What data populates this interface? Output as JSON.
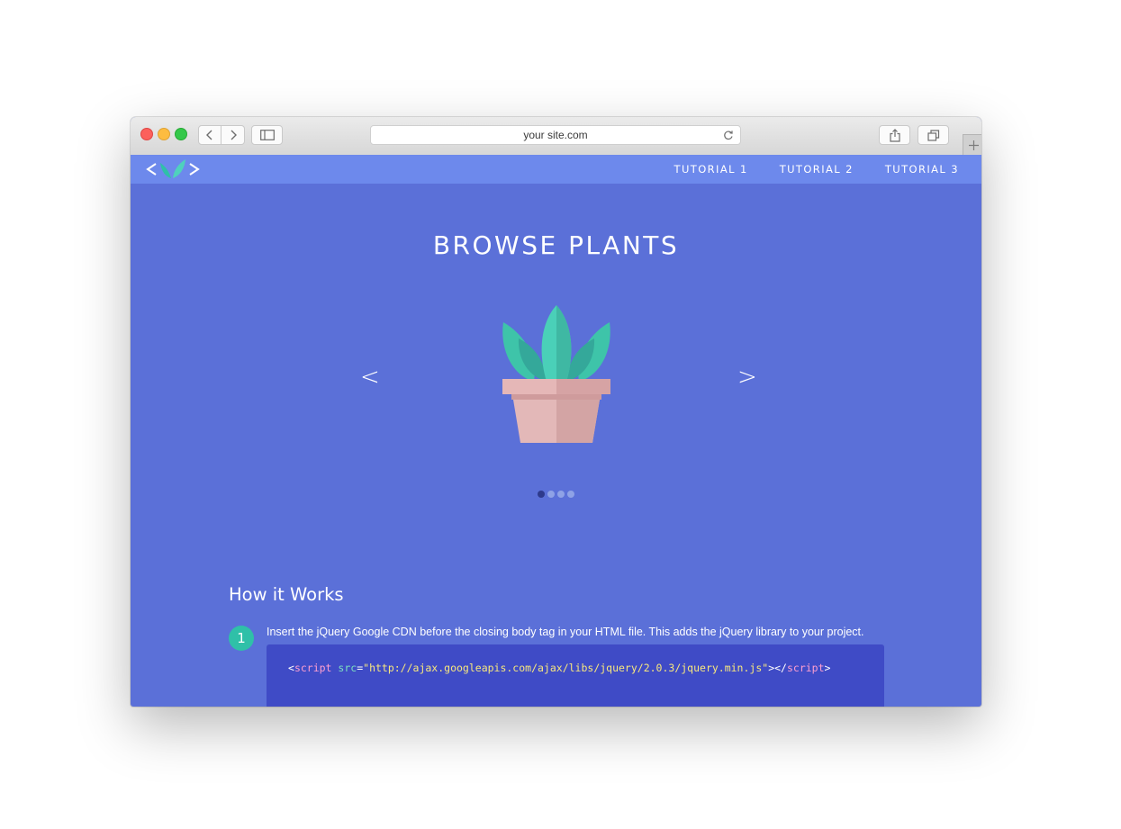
{
  "browser": {
    "url": "your site.com"
  },
  "nav": {
    "links": [
      "TUTORIAL 1",
      "TUTORIAL 2",
      "TUTORIAL 3"
    ]
  },
  "hero": {
    "title": "BROWSE PLANTS",
    "prev_label": "<",
    "next_label": ">",
    "slide_count": 4,
    "active_slide": 1
  },
  "how": {
    "title": "How it Works",
    "step_number": "1",
    "step_text": "Insert the jQuery Google CDN before the closing body tag in your HTML file. This adds the jQuery library to your project.",
    "code": {
      "open_bracket": "<",
      "tag": "script",
      "attr": "src",
      "equals": "=",
      "value": "\"http://ajax.googleapis.com/ajax/libs/jquery/2.0.3/jquery.min.js\"",
      "close_open": "></",
      "close_tag": "script",
      "end": ">"
    }
  },
  "colors": {
    "page_bg": "#5b70d8",
    "nav_bg": "#6d89ec",
    "accent_green": "#2fc0a8",
    "code_bg": "#3f4bc6"
  },
  "icons": [
    "back-icon",
    "forward-icon",
    "sidebar-icon",
    "reload-icon",
    "share-icon",
    "tabs-icon",
    "plus-icon",
    "logo-icon",
    "plant-icon"
  ]
}
